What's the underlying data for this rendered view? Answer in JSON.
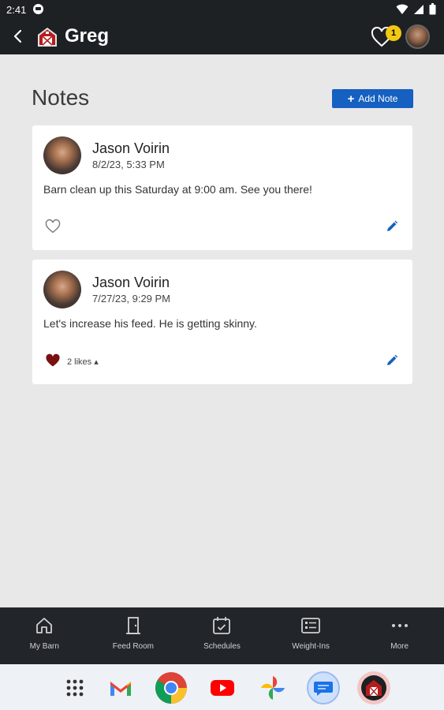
{
  "status_bar": {
    "time": "2:41"
  },
  "app_bar": {
    "title": "Greg",
    "notification_count": "1"
  },
  "page": {
    "title": "Notes",
    "add_note_label": "Add Note"
  },
  "notes": [
    {
      "author": "Jason Voirin",
      "date": "8/2/23, 5:33 PM",
      "text": "Barn clean up this Saturday at 9:00 am. See you there!",
      "liked": false,
      "likes_label": ""
    },
    {
      "author": "Jason Voirin",
      "date": "7/27/23, 9:29 PM",
      "text": "Let's increase his feed. He is getting skinny.",
      "liked": true,
      "likes_label": "2 likes ▴"
    }
  ],
  "bottom_nav": [
    {
      "label": "My Barn",
      "icon": "home-icon"
    },
    {
      "label": "Feed Room",
      "icon": "door-icon"
    },
    {
      "label": "Schedules",
      "icon": "calendar-check-icon"
    },
    {
      "label": "Weight-Ins",
      "icon": "checklist-icon"
    },
    {
      "label": "More",
      "icon": "more-horizontal-icon"
    }
  ],
  "colors": {
    "header_bg": "#1e2124",
    "accent_blue": "#1560c0",
    "badge_yellow": "#f2c811",
    "liked_red": "#7a1010",
    "page_bg": "#e8e8e8"
  }
}
